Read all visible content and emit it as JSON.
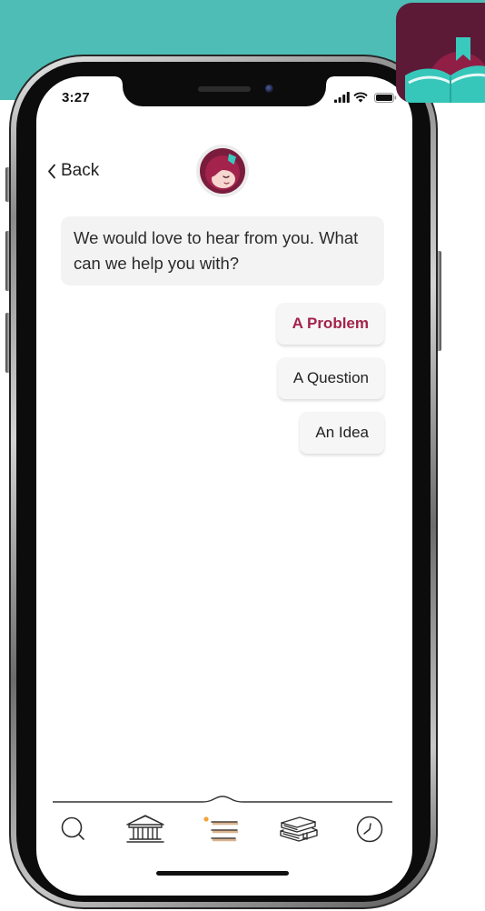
{
  "status_bar": {
    "time": "3:27"
  },
  "header": {
    "back_label": "Back"
  },
  "chat": {
    "message": "We would love to hear from you. What can we help you with?",
    "options": [
      {
        "label": "A Problem",
        "highlighted": true
      },
      {
        "label": "A Question",
        "highlighted": false
      },
      {
        "label": "An Idea",
        "highlighted": false
      }
    ]
  },
  "nav": {
    "items": [
      {
        "icon": "search-icon"
      },
      {
        "icon": "library-icon"
      },
      {
        "icon": "menu-icon",
        "has_indicator_dot": true
      },
      {
        "icon": "shelf-icon"
      },
      {
        "icon": "timeline-icon"
      }
    ]
  },
  "app_icon": {
    "icon": "libby-app-icon"
  },
  "colors": {
    "banner": "#4EBDB6",
    "accent": "#A3234C",
    "app_icon_background": "#5C1A37",
    "app_icon_book": "#37C6BA",
    "indicator_dot": "#F2A33A"
  }
}
